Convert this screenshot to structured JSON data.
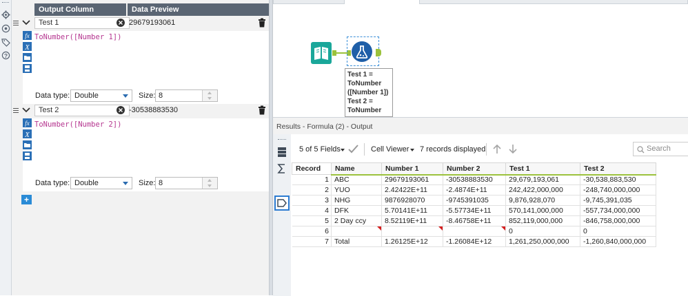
{
  "config": {
    "headers": {
      "output_column": "Output Column",
      "data_preview": "Data Preview"
    },
    "fields": [
      {
        "name": "Test 1",
        "preview": "29679193061",
        "formula": "ToNumber([Number 1])",
        "data_type_label": "Data type:",
        "data_type": "Double",
        "size_label": "Size:",
        "size": "8"
      },
      {
        "name": "Test 2",
        "preview": "-30538883530",
        "formula": "ToNumber([Number 2])",
        "data_type_label": "Data type:",
        "data_type": "Double",
        "size_label": "Size:",
        "size": "8"
      }
    ],
    "add_label": "+"
  },
  "canvas": {
    "annotation": [
      "Test 1 =",
      "ToNumber",
      "([Number 1])",
      "Test 2 =",
      "ToNumber"
    ]
  },
  "results": {
    "title": "Results - Formula (2) - Output",
    "fields_summary": "5 of 5 Fields",
    "viewer": "Cell Viewer",
    "records": "7 records displayed",
    "search_placeholder": "Search",
    "columns": [
      "Record",
      "Name",
      "Number 1",
      "Number 2",
      "Test 1",
      "Test 2"
    ],
    "rows": [
      {
        "rec": "1",
        "name": "ABC",
        "n1": "29679193061",
        "n2": "-30538883530",
        "t1": "29,679,193,061",
        "t2": "-30,538,883,530"
      },
      {
        "rec": "2",
        "name": "YUO",
        "n1": "2.42422E+11",
        "n2": "-2.4874E+11",
        "t1": "242,422,000,000",
        "t2": "-248,740,000,000"
      },
      {
        "rec": "3",
        "name": "NHG",
        "n1": "9876928070",
        "n2": "-9745391035",
        "t1": "9,876,928,070",
        "t2": "-9,745,391,035"
      },
      {
        "rec": "4",
        "name": "DFK",
        "n1": "5.70141E+11",
        "n2": "-5.57734E+11",
        "t1": "570,141,000,000",
        "t2": "-557,734,000,000"
      },
      {
        "rec": "5",
        "name": "2 Day ccy",
        "n1": "8.52119E+11",
        "n2": "-8.46758E+11",
        "t1": "852,119,000,000",
        "t2": "-846,758,000,000"
      },
      {
        "rec": "6",
        "name": "",
        "n1": "",
        "n2": "",
        "t1": "0",
        "t2": "0"
      },
      {
        "rec": "7",
        "name": "Total",
        "n1": "1.26125E+12",
        "n2": "-1.26084E+12",
        "t1": "1,261,250,000,000",
        "t2": "-1,260,840,000,000"
      }
    ]
  },
  "colors": {
    "accent": "#2a8bd6",
    "header": "#5a6573",
    "formula_text": "#b5358f",
    "input_tool": "#1aa79a",
    "formula_tool": "#1f5fa8",
    "connector": "#9bc23c",
    "null_marker": "#d61f1f"
  }
}
